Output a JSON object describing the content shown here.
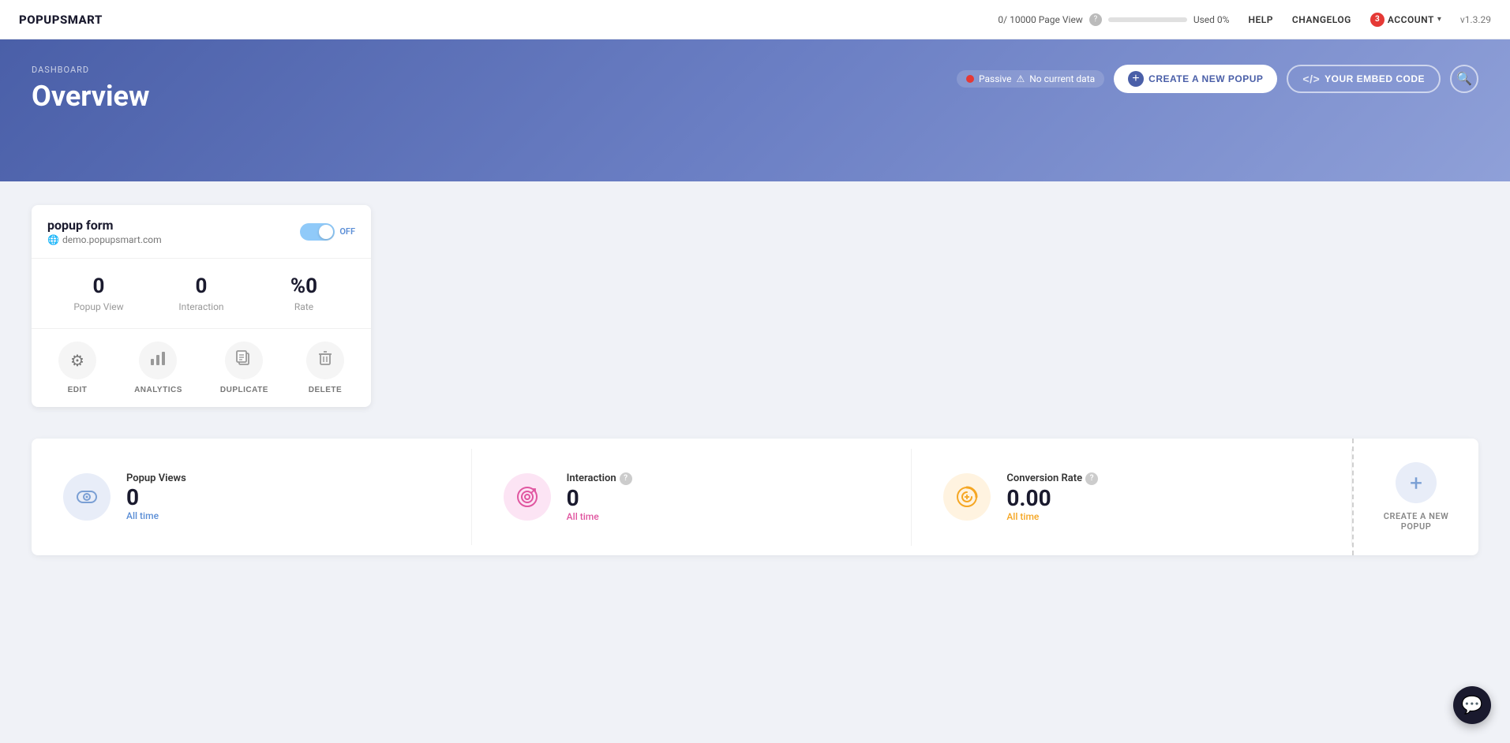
{
  "topnav": {
    "logo": "POPUPSMART",
    "page_view_text": "0/ 10000 Page View",
    "used_text": "Used 0%",
    "help_label": "HELP",
    "changelog_label": "CHANGELOG",
    "account_label": "ACCOUNT",
    "account_badge": "3",
    "version_label": "v1.3.29",
    "page_view_fill_pct": "0"
  },
  "header": {
    "breadcrumb": "DASHBOARD",
    "title": "Overview",
    "status_label": "Passive",
    "status_warning": "⚠",
    "no_data_label": "No current data",
    "btn_create_label": "CREATE A NEW POPUP",
    "btn_embed_label": "YOUR EMBED CODE",
    "help_tooltip": "?"
  },
  "popup_card": {
    "title": "popup form",
    "domain": "demo.popupsmart.com",
    "toggle_label": "OFF",
    "popup_view_value": "0",
    "popup_view_label": "Popup View",
    "interaction_value": "0",
    "interaction_label": "Interaction",
    "rate_value": "%0",
    "rate_label": "Rate",
    "actions": [
      {
        "label": "EDIT",
        "icon": "gear"
      },
      {
        "label": "ANALYTICS",
        "icon": "bar-chart"
      },
      {
        "label": "DUPLICATE",
        "icon": "duplicate"
      },
      {
        "label": "DELETE",
        "icon": "trash"
      }
    ]
  },
  "analytics": {
    "popup_views": {
      "label": "Popup Views",
      "value": "0",
      "sub_label": "All time"
    },
    "interaction": {
      "label": "Interaction",
      "value": "0",
      "sub_label": "All time"
    },
    "conversion_rate": {
      "label": "Conversion Rate",
      "value": "0.00",
      "sub_label": "All time"
    },
    "create_new_label": "CREATE A NEW POPUP"
  },
  "chat_widget": {
    "icon": "💬"
  }
}
